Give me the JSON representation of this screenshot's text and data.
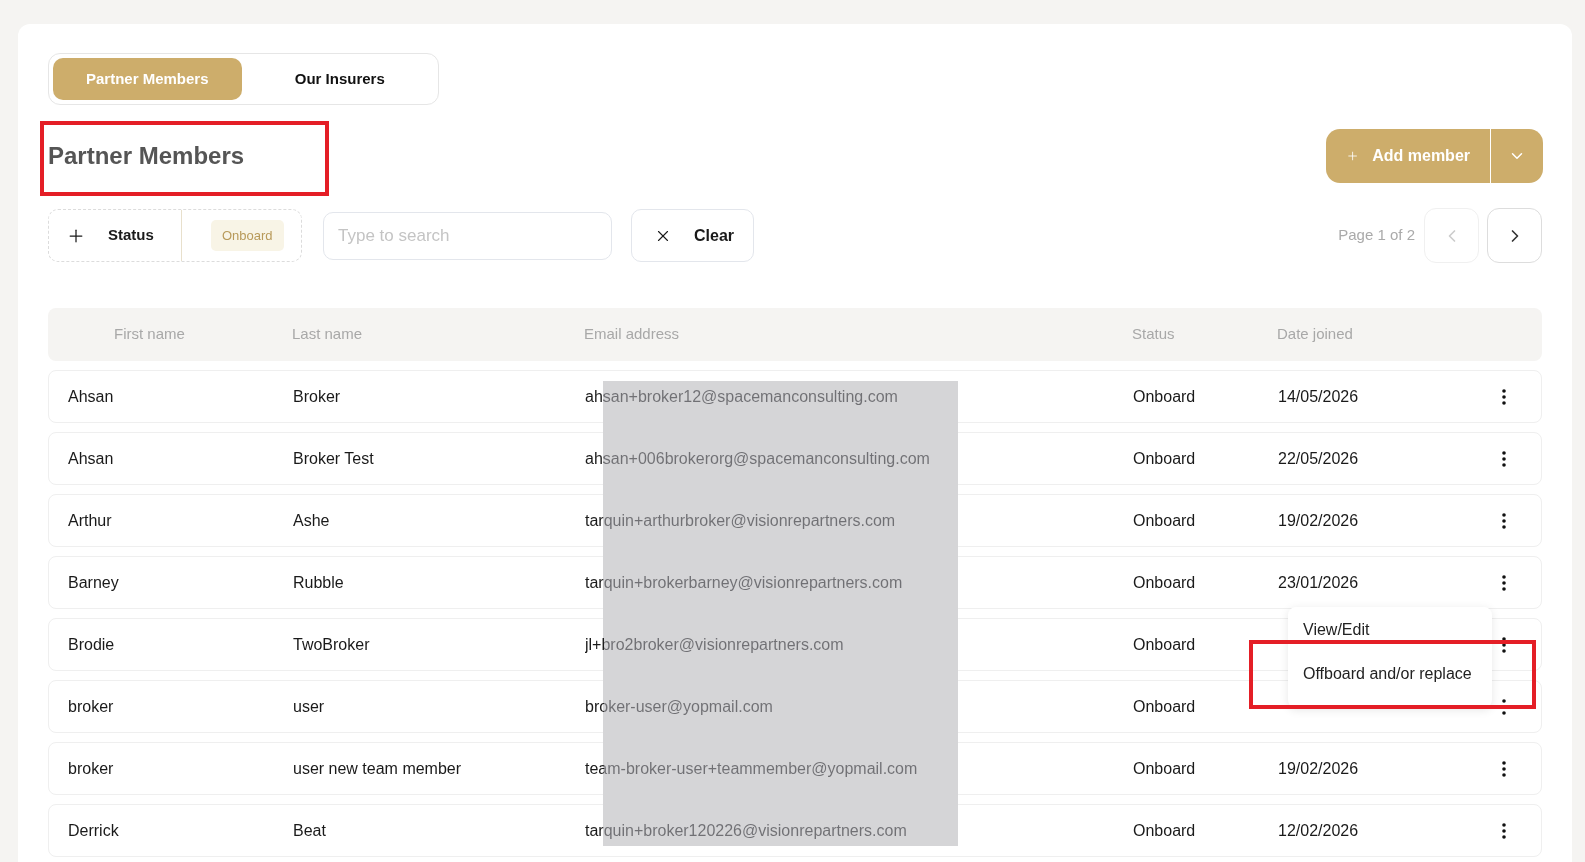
{
  "tabs": [
    {
      "label": "Partner Members",
      "selected": true
    },
    {
      "label": "Our Insurers",
      "selected": false
    }
  ],
  "heading": "Partner Members",
  "add_button": {
    "label": "Add member"
  },
  "filters": {
    "status_label": "Status",
    "status_chip": "Onboard",
    "search": {
      "placeholder": "Type to search"
    },
    "clear_label": "Clear"
  },
  "pagination": {
    "text": "Page 1 of 2",
    "prev_disabled": true,
    "next_disabled": false
  },
  "table": {
    "columns": [
      "First name",
      "Last name",
      "Email address",
      "Status",
      "Date joined"
    ],
    "rows": [
      {
        "first": "Ahsan",
        "last": "Broker",
        "email": "ahsan+broker12@spacemanconsulting.com",
        "status": "Onboard",
        "date": "14/05/2026"
      },
      {
        "first": "Ahsan",
        "last": "Broker Test",
        "email": "ahsan+006brokerorg@spacemanconsulting.com",
        "status": "Onboard",
        "date": "22/05/2026"
      },
      {
        "first": "Arthur",
        "last": "Ashe",
        "email": "tarquin+arthurbroker@visionrepartners.com",
        "status": "Onboard",
        "date": "19/02/2026"
      },
      {
        "first": "Barney",
        "last": "Rubble",
        "email": "tarquin+brokerbarney@visionrepartners.com",
        "status": "Onboard",
        "date": "23/01/2026"
      },
      {
        "first": "Brodie",
        "last": "TwoBroker",
        "email": "jl+bro2broker@visionrepartners.com",
        "status": "Onboard"
      },
      {
        "first": "broker",
        "last": "user",
        "email": "broker-user@yopmail.com",
        "status": "Onboard"
      },
      {
        "first": "broker",
        "last": "user new team member",
        "email": "team-broker-user+teammember@yopmail.com",
        "status": "Onboard",
        "date": "19/02/2026"
      },
      {
        "first": "Derrick",
        "last": "Beat",
        "email": "tarquin+broker120226@visionrepartners.com",
        "status": "Onboard",
        "date": "12/02/2026"
      }
    ]
  },
  "row_menu": {
    "items": [
      "View/Edit",
      "Offboard and/or replace"
    ]
  }
}
